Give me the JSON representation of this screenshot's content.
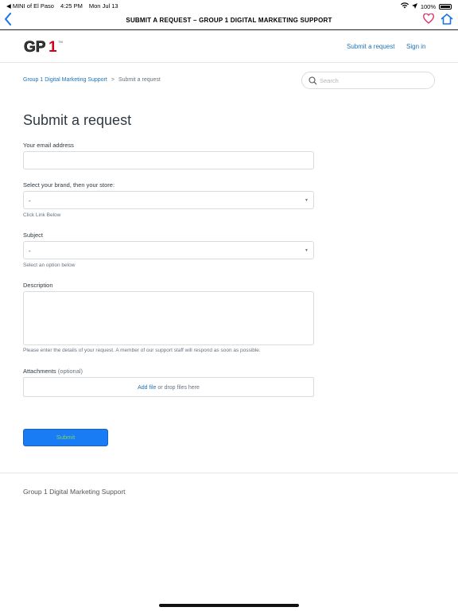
{
  "status_bar": {
    "carrier": "◀ MINI of El Paso",
    "time": "4:25 PM",
    "date": "Mon Jul 13",
    "battery": "100%"
  },
  "nav_bar": {
    "title": "SUBMIT A REQUEST – GROUP 1 DIGITAL MARKETING SUPPORT",
    "back_icon": "chevron-left-icon",
    "heart_icon": "heart-icon",
    "home_icon": "home-icon"
  },
  "header": {
    "logo_text": "GP1",
    "links": [
      "Submit a request",
      "Sign in"
    ]
  },
  "breadcrumb": {
    "items": [
      "Group 1 Digital Marketing Support",
      "Submit a request"
    ],
    "separator": ">"
  },
  "search": {
    "placeholder": "Search"
  },
  "form": {
    "title": "Submit a request",
    "email_label": "Your email address",
    "email_value": "",
    "brand_label": "Select your brand, then your store:",
    "brand_value": "-",
    "brand_hint": "Click Link Below",
    "subject_label": "Subject",
    "subject_value": "-",
    "subject_hint": "Select an option below",
    "description_label": "Description",
    "description_value": "",
    "description_hint": "Please enter the details of your request. A member of our support staff will respond as soon as possible.",
    "attachments_label": "Attachments",
    "attachments_optional": "(optional)",
    "add_file": "Add file",
    "drop_text": "or drop files here",
    "submit_label": "Submit"
  },
  "footer": {
    "text": "Group 1 Digital Marketing Support"
  },
  "colors": {
    "link": "#1f73b7",
    "submit_bg": "#1a7cf5",
    "back_icon": "#1a73e8",
    "heart": "#e0245e"
  }
}
